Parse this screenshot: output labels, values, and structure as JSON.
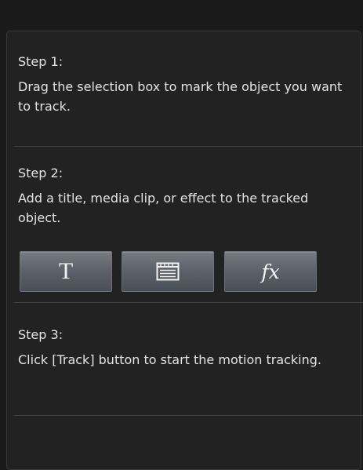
{
  "steps": [
    {
      "title": "Step 1:",
      "text": "Drag the selection box to mark the object you want to track."
    },
    {
      "title": "Step 2:",
      "text": "Add a title, media clip, or effect to the tracked object."
    },
    {
      "title": "Step 3:",
      "text": "Click [Track] button to start the motion tracking."
    }
  ],
  "buttons": {
    "title_glyph": "T",
    "title_icon": "text-title-icon",
    "media_icon": "media-clip-icon",
    "effect_glyph": "fx",
    "effect_icon": "fx-effect-icon"
  },
  "colors": {
    "background": "#1a1a1a",
    "panel": "#222222",
    "text": "#e4e4e4",
    "button": "#5e636b"
  }
}
